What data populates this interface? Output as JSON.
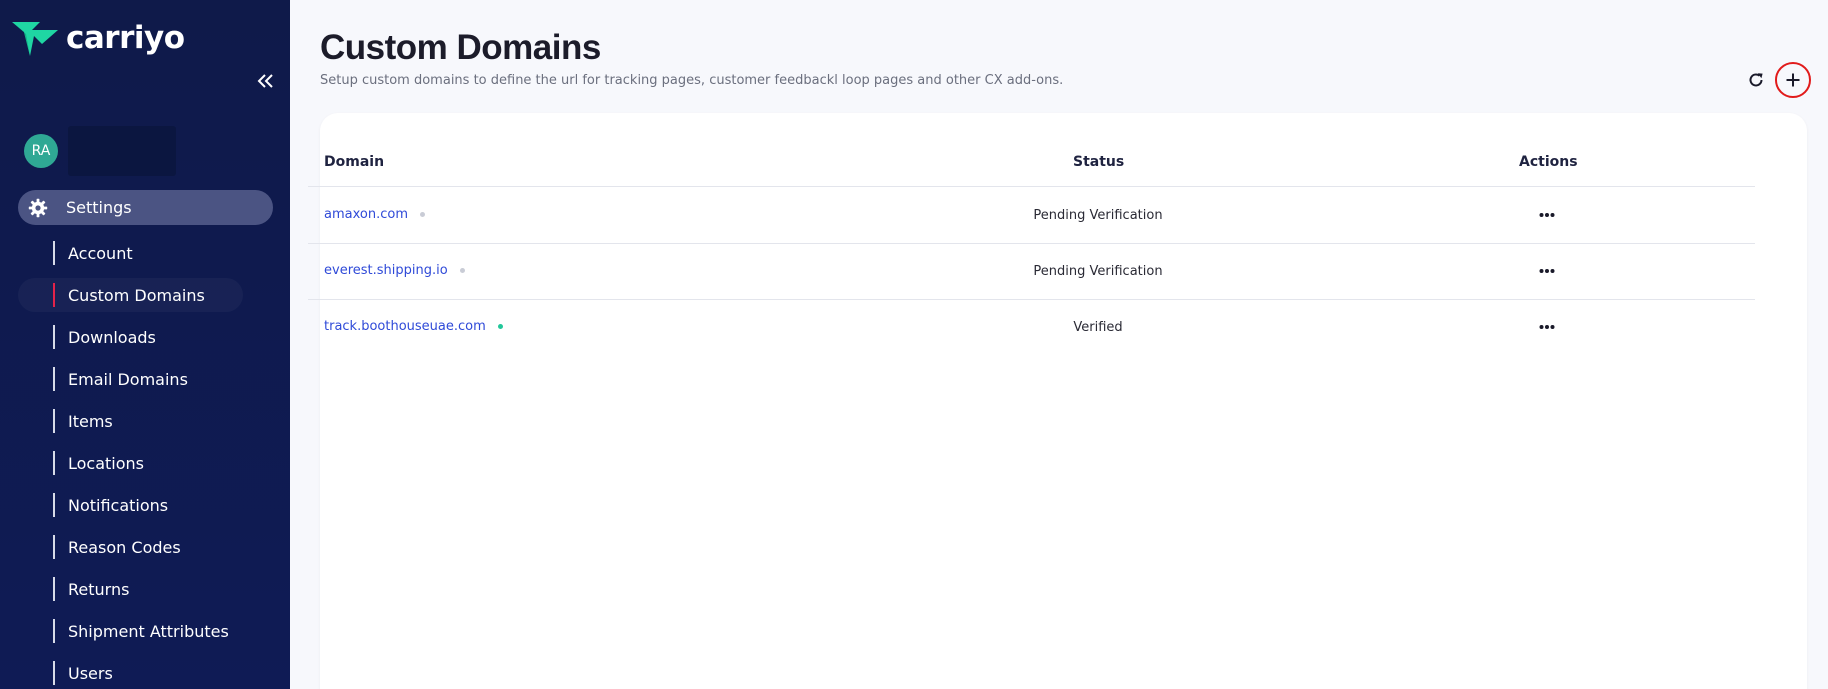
{
  "brand": {
    "name": "carriyo",
    "logo_color": "#1fd6a3"
  },
  "user": {
    "initials": "RA",
    "avatar_color": "#2fa894"
  },
  "sidebar": {
    "section_label": "Settings",
    "items": [
      {
        "label": "Account"
      },
      {
        "label": "Custom Domains",
        "active": true
      },
      {
        "label": "Downloads"
      },
      {
        "label": "Email Domains"
      },
      {
        "label": "Items"
      },
      {
        "label": "Locations"
      },
      {
        "label": "Notifications"
      },
      {
        "label": "Reason Codes"
      },
      {
        "label": "Returns"
      },
      {
        "label": "Shipment Attributes"
      },
      {
        "label": "Users"
      }
    ],
    "active_indicator_color": "#e3234a"
  },
  "page": {
    "title": "Custom Domains",
    "subtitle": "Setup custom domains to define the url for tracking pages, customer feedbackl loop pages and other CX add-ons."
  },
  "toolbar": {
    "refresh_icon": "refresh-icon",
    "add_icon": "plus-icon",
    "highlight_color": "#e11b1b"
  },
  "table": {
    "columns": [
      "Domain",
      "Status",
      "Actions"
    ],
    "rows": [
      {
        "domain": "amaxon.com",
        "status": "Pending Verification",
        "dot_color": "#c9ccd6"
      },
      {
        "domain": "everest.shipping.io",
        "status": "Pending Verification",
        "dot_color": "#c9ccd6"
      },
      {
        "domain": "track.boothouseuae.com",
        "status": "Verified",
        "dot_color": "#22c79a"
      }
    ]
  }
}
